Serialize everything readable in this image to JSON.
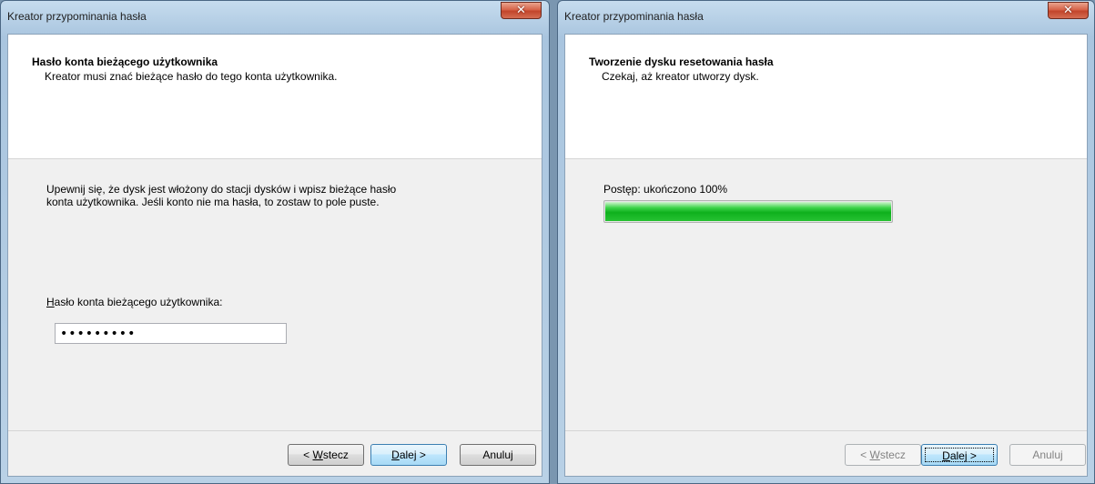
{
  "left_window": {
    "title": "Kreator przypominania hasła",
    "header_title": "Hasło konta bieżącego użytkownika",
    "header_subtitle": "Kreator musi znać bieżące hasło do tego konta użytkownika.",
    "instructions": "Upewnij się, że dysk jest włożony do stacji dysków i wpisz bieżące hasło\nkonta użytkownika. Jeśli konto nie ma hasła, to zostaw to pole puste.",
    "field_label_accel": "H",
    "field_label_rest": "asło konta bieżącego użytkownika:",
    "password_value": "•••••••••",
    "back": {
      "prefix": "< ",
      "accel": "W",
      "rest": "stecz"
    },
    "next": {
      "accel": "D",
      "rest": "alej >"
    },
    "cancel_label": "Anuluj"
  },
  "right_window": {
    "title": "Kreator przypominania hasła",
    "header_title": "Tworzenie dysku resetowania hasła",
    "header_subtitle": "Czekaj, aż kreator utworzy dysk.",
    "progress_label": "Postęp: ukończono 100%",
    "progress_fraction": 1.0,
    "back": {
      "prefix": "< ",
      "accel": "W",
      "rest": "stecz"
    },
    "next": {
      "accel": "D",
      "rest": "alej >"
    },
    "cancel_label": "Anuluj"
  },
  "icons": {
    "close": "close-icon"
  },
  "colors": {
    "close_button": "#c2452b",
    "progress_green": "#0fb01d",
    "default_button_border": "#3c7fb1"
  }
}
